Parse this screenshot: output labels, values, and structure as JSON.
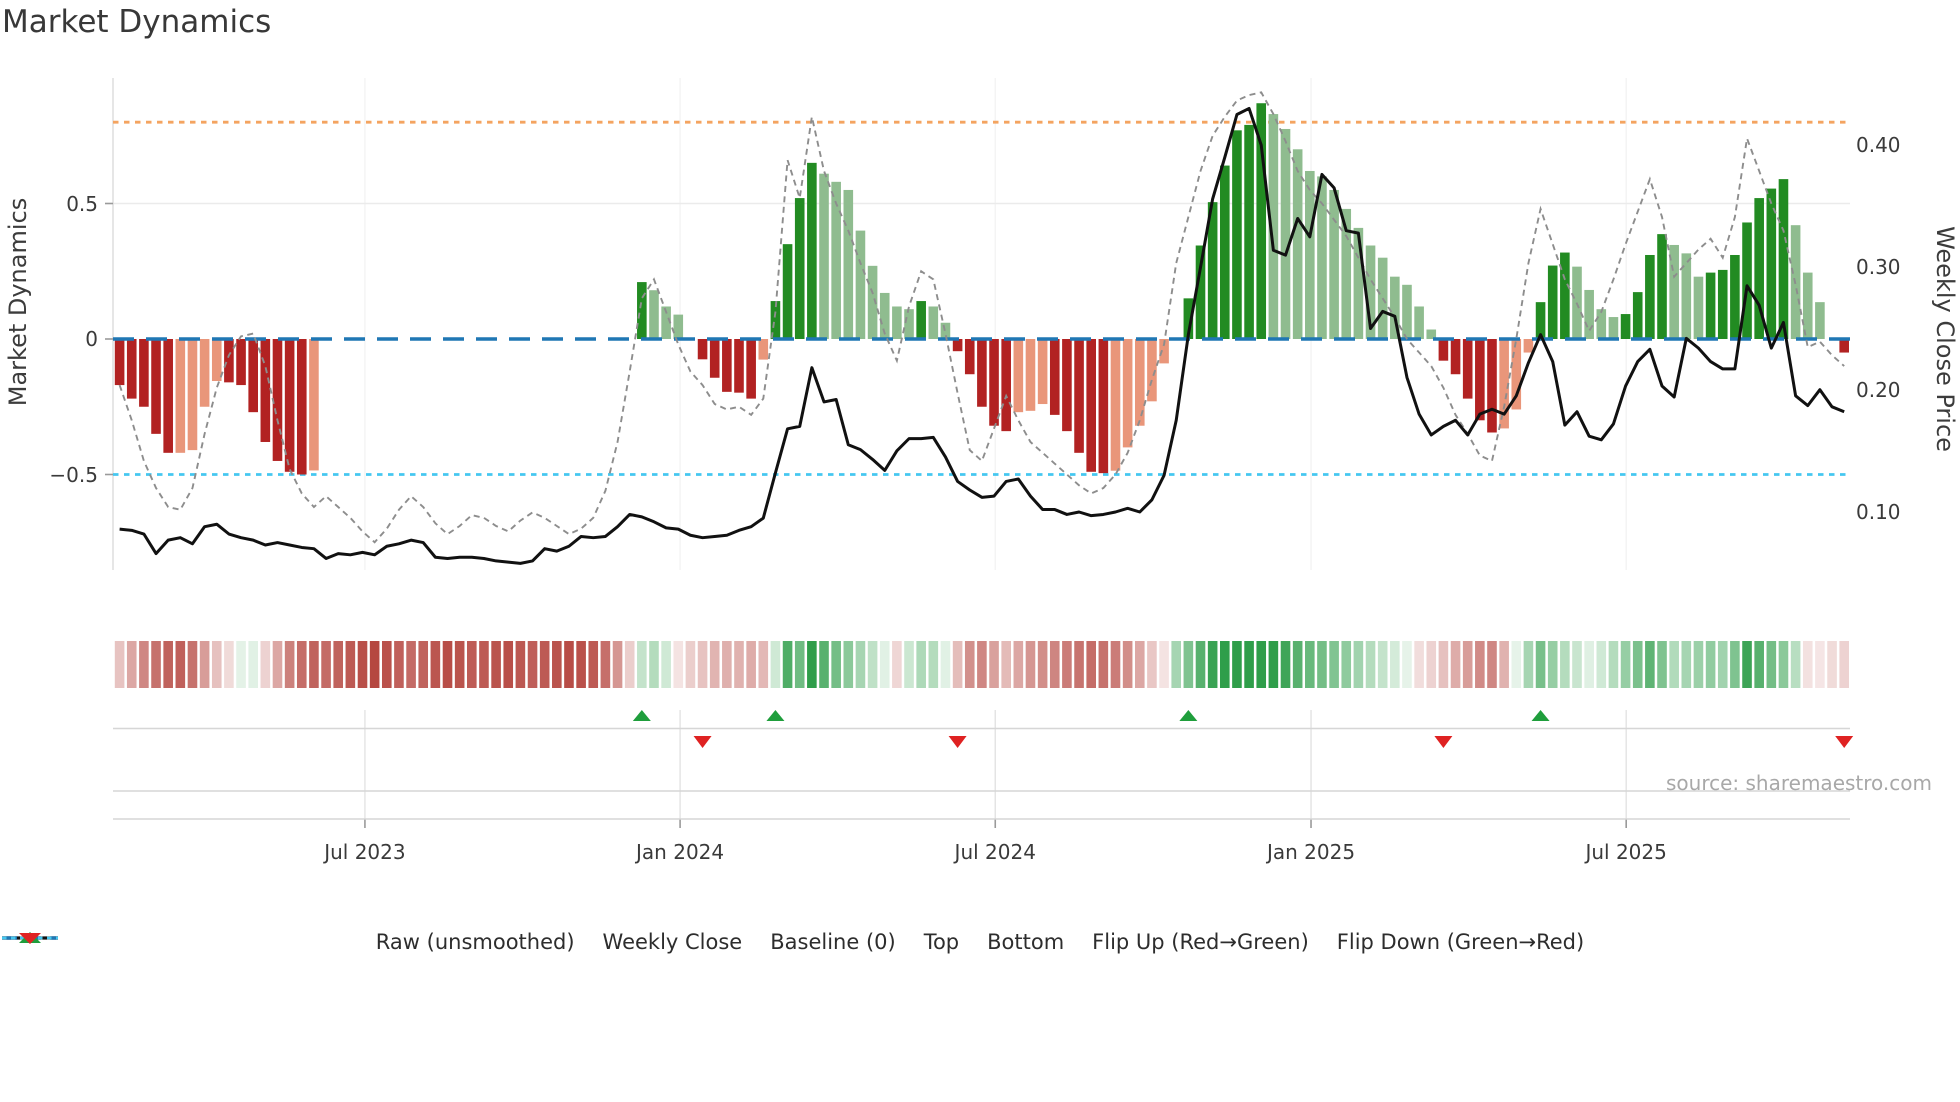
{
  "title": "Market Dynamics",
  "source_text": "source: sharemaestro.com",
  "axes": {
    "left_label": "Market Dynamics",
    "right_label": "Weekly Close Price",
    "left_ticks": [
      {
        "value": 0.5,
        "label": "0.5"
      },
      {
        "value": 0.0,
        "label": "0"
      },
      {
        "value": -0.5,
        "label": "−0.5"
      }
    ],
    "right_ticks": [
      {
        "value": 0.4,
        "label": "0.40"
      },
      {
        "value": 0.3,
        "label": "0.30"
      },
      {
        "value": 0.2,
        "label": "0.20"
      },
      {
        "value": 0.1,
        "label": "0.10"
      }
    ],
    "x_ticks": [
      {
        "label": "Jul 2023",
        "week": 20.2
      },
      {
        "label": "Jan 2024",
        "week": 46.15
      },
      {
        "label": "Jul 2024",
        "week": 72.1
      },
      {
        "label": "Jan 2025",
        "week": 98.1
      },
      {
        "label": "Jul 2025",
        "week": 124.05
      }
    ]
  },
  "legend": [
    {
      "label": "Raw (unsmoothed)",
      "swatch": "dash-gray"
    },
    {
      "label": "Weekly Close",
      "swatch": "line-black"
    },
    {
      "label": "Baseline (0)",
      "swatch": "dash-blue"
    },
    {
      "label": "Top",
      "swatch": "dot-orange"
    },
    {
      "label": "Bottom",
      "swatch": "dot-cyan"
    },
    {
      "label": "Flip Up (Red→Green)",
      "swatch": "tri-up"
    },
    {
      "label": "Flip Down (Green→Red)",
      "swatch": "tri-down"
    }
  ],
  "colors": {
    "bar_pos_dark": "#228B22",
    "bar_pos_light": "#8FBC8F",
    "bar_neg_dark": "#B22222",
    "bar_neg_light": "#E9967A",
    "baseline": "#1F77B4",
    "top_line": "#F4A460",
    "bottom_line": "#45C7F0",
    "raw_line": "#8D8D8D",
    "price_line": "#111111",
    "flip_up": "#1F9E3C",
    "flip_down": "#DF2222",
    "heat_pos": "#2F9E4A",
    "heat_neg": "#B13C35",
    "grid": "#EBEBEB",
    "panel_line": "#D6D6D6",
    "tick": "#9A9A9A"
  },
  "chart_data": {
    "type": "combo (bar oscillator + lines + heatmap + flip markers)",
    "weeks": 143,
    "baseline": 0,
    "top": 0.8,
    "bottom": -0.5,
    "ylim_left": [
      -0.85,
      0.96
    ],
    "ylim_right_price": [
      0.053,
      0.455
    ],
    "grid": "horizontal 0.5 line, vertical date gridlines (faint)",
    "legend_position": "bottom center",
    "series": [
      {
        "name": "Oscillator bars",
        "axis": "left",
        "values": [
          -0.17,
          -0.22,
          -0.25,
          -0.35,
          -0.42,
          -0.42,
          -0.41,
          -0.25,
          -0.155,
          -0.16,
          -0.17,
          -0.27,
          -0.38,
          -0.45,
          -0.49,
          -0.5,
          -0.485,
          0,
          0,
          0,
          0,
          0,
          0,
          0,
          0,
          0,
          0,
          0,
          0,
          0,
          0,
          0,
          0,
          0,
          0,
          0,
          0,
          0,
          0,
          0,
          0,
          0,
          0,
          0.21,
          0.18,
          0.12,
          0.09,
          0,
          -0.075,
          -0.143,
          -0.195,
          -0.198,
          -0.22,
          -0.076,
          0.14,
          0.35,
          0.52,
          0.65,
          0.61,
          0.58,
          0.55,
          0.4,
          0.27,
          0.17,
          0.12,
          0.11,
          0.14,
          0.12,
          0.06,
          -0.045,
          -0.13,
          -0.25,
          -0.32,
          -0.34,
          -0.27,
          -0.265,
          -0.24,
          -0.28,
          -0.34,
          -0.42,
          -0.49,
          -0.495,
          -0.486,
          -0.4,
          -0.32,
          -0.23,
          -0.09,
          0,
          0.15,
          0.345,
          0.505,
          0.64,
          0.77,
          0.79,
          0.87,
          0.83,
          0.775,
          0.7,
          0.62,
          0.6,
          0.55,
          0.48,
          0.41,
          0.345,
          0.3,
          0.23,
          0.2,
          0.12,
          0.035,
          -0.08,
          -0.13,
          -0.22,
          -0.3,
          -0.345,
          -0.33,
          -0.26,
          -0.05,
          0.136,
          0.271,
          0.319,
          0.267,
          0.181,
          0.11,
          0.081,
          0.092,
          0.173,
          0.31,
          0.387,
          0.347,
          0.316,
          0.23,
          0.245,
          0.255,
          0.31,
          0.43,
          0.52,
          0.555,
          0.59,
          0.42,
          0.245,
          0.136,
          0,
          -0.05
        ]
      },
      {
        "name": "Raw (unsmoothed)",
        "axis": "left",
        "values": [
          -0.17,
          -0.3,
          -0.45,
          -0.55,
          -0.62,
          -0.63,
          -0.55,
          -0.35,
          -0.18,
          -0.06,
          0.01,
          0.02,
          -0.1,
          -0.3,
          -0.48,
          -0.57,
          -0.62,
          -0.58,
          -0.62,
          -0.66,
          -0.71,
          -0.75,
          -0.7,
          -0.63,
          -0.58,
          -0.62,
          -0.68,
          -0.72,
          -0.69,
          -0.65,
          -0.66,
          -0.69,
          -0.71,
          -0.67,
          -0.64,
          -0.66,
          -0.69,
          -0.72,
          -0.7,
          -0.66,
          -0.56,
          -0.38,
          -0.12,
          0.15,
          0.22,
          0.1,
          -0.02,
          -0.12,
          -0.17,
          -0.24,
          -0.26,
          -0.25,
          -0.28,
          -0.22,
          0.1,
          0.66,
          0.52,
          0.82,
          0.62,
          0.5,
          0.4,
          0.28,
          0.17,
          0.02,
          -0.08,
          0.12,
          0.25,
          0.22,
          0.02,
          -0.2,
          -0.41,
          -0.45,
          -0.33,
          -0.21,
          -0.3,
          -0.38,
          -0.42,
          -0.46,
          -0.5,
          -0.54,
          -0.57,
          -0.55,
          -0.5,
          -0.42,
          -0.3,
          -0.15,
          -0.02,
          0.28,
          0.45,
          0.62,
          0.75,
          0.82,
          0.88,
          0.9,
          0.91,
          0.83,
          0.73,
          0.62,
          0.55,
          0.5,
          0.44,
          0.38,
          0.3,
          0.22,
          0.15,
          0.08,
          0,
          -0.05,
          -0.1,
          -0.18,
          -0.28,
          -0.35,
          -0.43,
          -0.45,
          -0.25,
          0,
          0.28,
          0.48,
          0.35,
          0.22,
          0.13,
          0.03,
          0.1,
          0.22,
          0.35,
          0.47,
          0.59,
          0.45,
          0.23,
          0.28,
          0.33,
          0.37,
          0.3,
          0.45,
          0.74,
          0.62,
          0.5,
          0.4,
          0.2,
          -0.03,
          -0.01,
          -0.06,
          -0.1
        ]
      },
      {
        "name": "Weekly Close",
        "axis": "right",
        "values": [
          0.086,
          0.085,
          0.082,
          0.066,
          0.077,
          0.079,
          0.074,
          0.088,
          0.09,
          0.082,
          0.079,
          0.077,
          0.073,
          0.075,
          0.073,
          0.071,
          0.07,
          0.062,
          0.066,
          0.065,
          0.067,
          0.065,
          0.072,
          0.074,
          0.077,
          0.075,
          0.063,
          0.062,
          0.063,
          0.063,
          0.062,
          0.06,
          0.059,
          0.058,
          0.06,
          0.07,
          0.068,
          0.072,
          0.08,
          0.079,
          0.08,
          0.088,
          0.098,
          0.096,
          0.092,
          0.087,
          0.086,
          0.081,
          0.079,
          0.08,
          0.081,
          0.085,
          0.088,
          0.095,
          0.132,
          0.168,
          0.17,
          0.218,
          0.19,
          0.192,
          0.155,
          0.151,
          0.143,
          0.134,
          0.15,
          0.16,
          0.16,
          0.161,
          0.145,
          0.125,
          0.118,
          0.112,
          0.113,
          0.125,
          0.127,
          0.113,
          0.102,
          0.102,
          0.098,
          0.1,
          0.097,
          0.098,
          0.1,
          0.103,
          0.1,
          0.11,
          0.13,
          0.175,
          0.245,
          0.3,
          0.356,
          0.39,
          0.425,
          0.43,
          0.4,
          0.314,
          0.31,
          0.34,
          0.325,
          0.376,
          0.365,
          0.33,
          0.328,
          0.25,
          0.264,
          0.26,
          0.21,
          0.18,
          0.163,
          0.17,
          0.175,
          0.163,
          0.18,
          0.184,
          0.18,
          0.195,
          0.222,
          0.245,
          0.223,
          0.171,
          0.182,
          0.162,
          0.159,
          0.172,
          0.203,
          0.223,
          0.233,
          0.203,
          0.194,
          0.242,
          0.234,
          0.223,
          0.217,
          0.217,
          0.285,
          0.269,
          0.234,
          0.255,
          0.195,
          0.187,
          0.2,
          0.186,
          0.182
        ]
      }
    ],
    "flip_up_weeks": [
      43,
      54,
      88,
      117
    ],
    "flip_down_weeks": [
      48,
      69,
      109,
      142
    ],
    "heatmap": "one cell per week, color = sign/magnitude of raw series (red negative, green positive)"
  }
}
